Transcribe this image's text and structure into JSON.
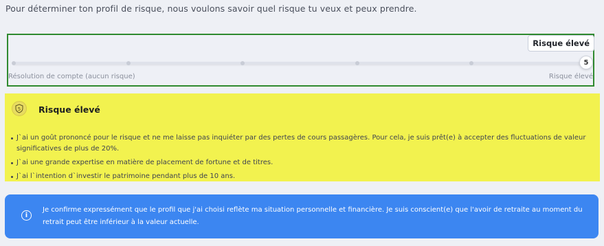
{
  "intro": "Pour déterminer ton profil de risque, nous voulons savoir quel risque tu veux et peux prendre.",
  "slider": {
    "tooltip": "Risque élevé",
    "value": 5,
    "value_label": "5",
    "levels": 6,
    "min_label": "Résolution de compte (aucun risque)",
    "max_label": "Risque élevé"
  },
  "risk": {
    "icon_label": "5",
    "title": "Risque élevé",
    "items": [
      "J`ai un goût prononcé pour le risque et ne me laisse pas inquiéter par des pertes de cours passagères. Pour cela, je suis prêt(e) à accepter des fluctuations de valeur significatives de plus de 20%.",
      "J`ai une grande expertise en matière de placement de fortune et de titres.",
      "J`ai l`intention d`investir le patrimoine pendant plus de 10 ans."
    ]
  },
  "confirm": {
    "text": "Je confirme expressément que le profil que j'ai choisi reflète ma situation personnelle et financière. Je suis conscient(e) que l'avoir de retraite au moment du retrait peut être inférieur à la valeur actuelle."
  },
  "colors": {
    "highlight_border": "#2f8a2f",
    "risk_card_bg": "#f2f24f",
    "confirm_bg": "#3c86f1"
  }
}
